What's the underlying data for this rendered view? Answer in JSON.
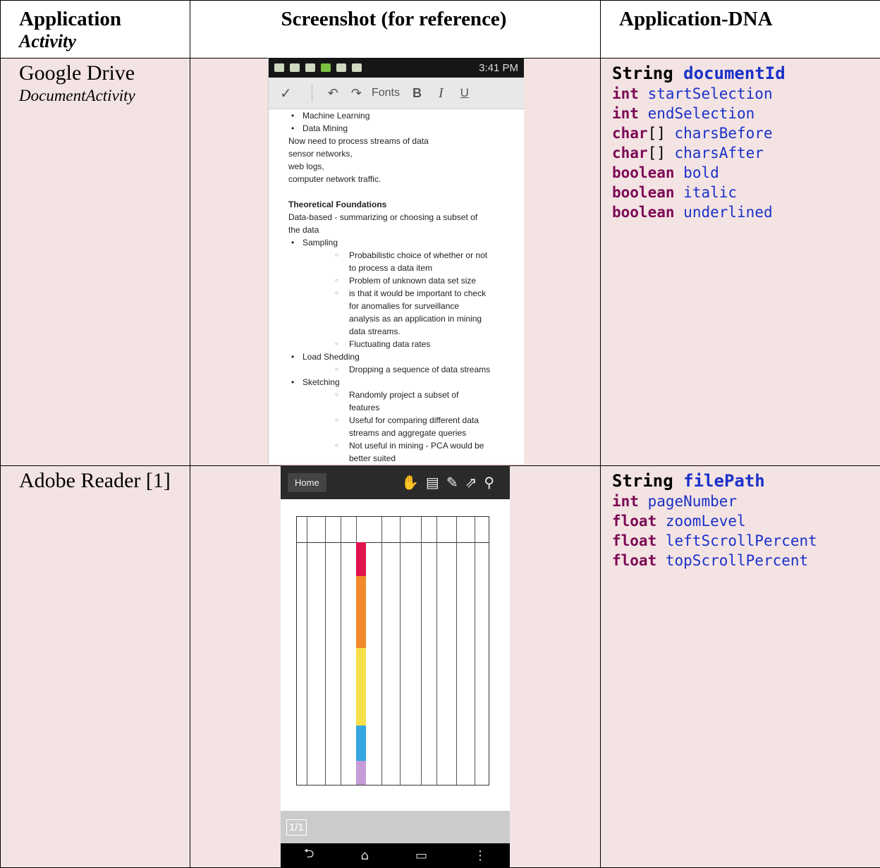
{
  "header": {
    "col1_title": "Application",
    "col1_sub": "Activity",
    "col2_title": "Screenshot (for reference)",
    "col3_title": "Application-DNA"
  },
  "rows": [
    {
      "app": "Google Drive",
      "activity": "DocumentActivity",
      "dna_head_type": "String",
      "dna_head_id": "documentId",
      "dna_fields": [
        {
          "type": "int",
          "suffix": "",
          "name": "startSelection"
        },
        {
          "type": "int",
          "suffix": "",
          "name": "endSelection"
        },
        {
          "type": "char",
          "suffix": "[]",
          "name": "charsBefore"
        },
        {
          "type": "char",
          "suffix": "[]",
          "name": "charsAfter"
        },
        {
          "type": "boolean",
          "suffix": "",
          "name": "bold"
        },
        {
          "type": "boolean",
          "suffix": "",
          "name": "italic"
        },
        {
          "type": "boolean",
          "suffix": "",
          "name": "underlined"
        }
      ]
    },
    {
      "app": "Adobe Reader [1]",
      "activity": "",
      "dna_head_type": "String",
      "dna_head_id": "filePath",
      "dna_fields": [
        {
          "type": "int",
          "suffix": "",
          "name": "pageNumber"
        },
        {
          "type": "float",
          "suffix": "",
          "name": "zoomLevel"
        },
        {
          "type": "float",
          "suffix": "",
          "name": "leftScrollPercent"
        },
        {
          "type": "float",
          "suffix": "",
          "name": "topScrollPercent"
        }
      ]
    }
  ],
  "drive_shot": {
    "time": "3:41 PM",
    "toolbar_fonts": "Fonts",
    "lines": [
      {
        "kind": "b1",
        "text": "Machine Learning"
      },
      {
        "kind": "b1",
        "text": "Data Mining"
      },
      {
        "kind": "p",
        "text": "Now need to process streams of data"
      },
      {
        "kind": "p",
        "text": "sensor networks,"
      },
      {
        "kind": "p",
        "text": "web logs,"
      },
      {
        "kind": "p",
        "text": "computer network traffic."
      },
      {
        "kind": "blank",
        "text": ""
      },
      {
        "kind": "bold",
        "text": "Theoretical Foundations"
      },
      {
        "kind": "p",
        "text": "Data-based - summarizing or choosing a subset of"
      },
      {
        "kind": "p",
        "text": "the data"
      },
      {
        "kind": "b1",
        "text": "Sampling"
      },
      {
        "kind": "b2",
        "text": "Probabilistic choice of whether or not"
      },
      {
        "kind": "b2c",
        "text": "to process a data item"
      },
      {
        "kind": "b2",
        "text": "Problem of unknown data set size"
      },
      {
        "kind": "b2",
        "text": "is that it would be important to check"
      },
      {
        "kind": "b2c",
        "text": "for anomalies for surveillance"
      },
      {
        "kind": "b2c",
        "text": "analysis as an application in mining"
      },
      {
        "kind": "b2c",
        "text": "data streams."
      },
      {
        "kind": "b2",
        "text": "Fluctuating data rates"
      },
      {
        "kind": "b1",
        "text": "Load Shedding"
      },
      {
        "kind": "b2",
        "text": "Dropping a sequence of data streams"
      },
      {
        "kind": "b1",
        "text": "Sketching"
      },
      {
        "kind": "b2",
        "text": "Randomly project a subset of"
      },
      {
        "kind": "b2c",
        "text": "features"
      },
      {
        "kind": "b2",
        "text": "Useful for comparing different data"
      },
      {
        "kind": "b2c",
        "text": "streams and aggregate queries"
      },
      {
        "kind": "b2",
        "text": "Not useful in mining - PCA would be"
      },
      {
        "kind": "b2c",
        "text": "better suited"
      }
    ]
  },
  "reader_shot": {
    "home_label": "Home",
    "page_current": "1",
    "page_total": "/1"
  }
}
